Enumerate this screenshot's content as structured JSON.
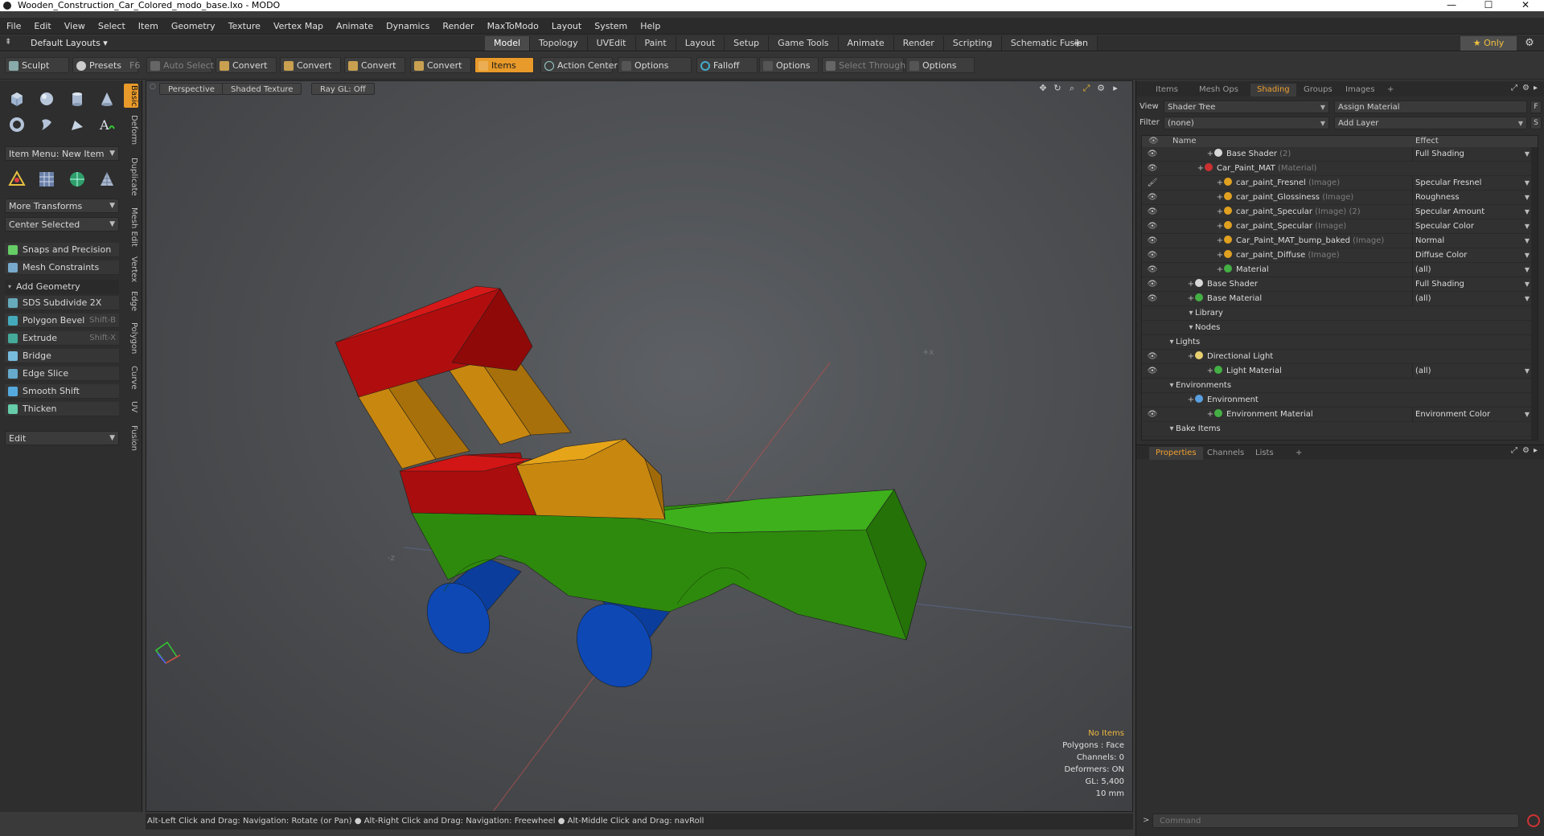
{
  "window": {
    "title": "Wooden_Construction_Car_Colored_modo_base.lxo - MODO",
    "minimize": "—",
    "maximize": "☐",
    "close": "✕"
  },
  "menu": [
    "File",
    "Edit",
    "View",
    "Select",
    "Item",
    "Geometry",
    "Texture",
    "Vertex Map",
    "Animate",
    "Dynamics",
    "Render",
    "MaxToModo",
    "Layout",
    "System",
    "Help"
  ],
  "layout": {
    "name": "Default Layouts ▾",
    "tabs": [
      "Model",
      "Topology",
      "UVEdit",
      "Paint",
      "Layout",
      "Setup",
      "Game Tools",
      "Animate",
      "Render",
      "Scripting",
      "Schematic Fusion"
    ],
    "active_tab": "Model",
    "add": "+",
    "only": "★  Only",
    "gear": "⚙"
  },
  "toolbar": {
    "sculpt": "Sculpt",
    "presets": "Presets",
    "presets_shortcut": "F6",
    "auto_select": "Auto Select",
    "convert1": "Convert",
    "convert2": "Convert",
    "convert3": "Convert",
    "convert4": "Convert",
    "items": "Items",
    "action_center": "Action Center",
    "options1": "Options",
    "falloff": "Falloff",
    "options2": "Options",
    "select_through": "Select Through",
    "options3": "Options"
  },
  "left": {
    "vtabs": [
      "Basic",
      "Deform",
      "Duplicate",
      "Mesh Edit",
      "Vertex",
      "Edge",
      "Polygon",
      "Curve",
      "UV",
      "Fusion"
    ],
    "item_menu": "Item Menu: New Item",
    "more_transforms": "More Transforms",
    "center_selected": "Center Selected",
    "snaps": "Snaps and Precision",
    "mesh_constraints": "Mesh Constraints",
    "add_geometry": "Add Geometry",
    "tools": [
      {
        "label": "SDS Subdivide 2X",
        "shortcut": ""
      },
      {
        "label": "Polygon Bevel",
        "shortcut": "Shift-B"
      },
      {
        "label": "Extrude",
        "shortcut": "Shift-X"
      },
      {
        "label": "Bridge",
        "shortcut": ""
      },
      {
        "label": "Edge Slice",
        "shortcut": ""
      },
      {
        "label": "Smooth Shift",
        "shortcut": ""
      },
      {
        "label": "Thicken",
        "shortcut": ""
      }
    ],
    "edit": "Edit"
  },
  "viewport": {
    "perspective": "Perspective",
    "shaded": "Shaded Texture",
    "raygl": "Ray GL: Off",
    "stats": {
      "items": "No Items",
      "polygons": "Polygons : Face",
      "channels": "Channels: 0",
      "deformers": "Deformers: ON",
      "gl": "GL: 5,400",
      "scale": "10 mm"
    }
  },
  "status": "Alt-Left Click and Drag: Navigation: Rotate (or Pan) ● Alt-Right Click and Drag: Navigation: Freewheel ● Alt-Middle Click and Drag: navRoll",
  "right": {
    "tabs": [
      "Items",
      "Mesh Ops",
      "Shading",
      "Groups",
      "Images",
      "+"
    ],
    "active_tab": "Shading",
    "view_label": "View",
    "view_value": "Shader Tree",
    "assign": "Assign Material",
    "f_btn": "F",
    "filter_label": "Filter",
    "filter_value": "(none)",
    "add_layer": "Add Layer",
    "s_btn": "S",
    "col_name": "Name",
    "col_effect": "Effect",
    "rows": [
      {
        "name": "Base Shader",
        "sub": "(2)",
        "effect": "Full Shading",
        "indent": 5,
        "color": "#d8d8d8",
        "eye": "👁"
      },
      {
        "name": "Car_Paint_MAT",
        "sub": "(Material)",
        "effect": "",
        "indent": 4,
        "color": "#cc3030",
        "eye": "👁"
      },
      {
        "name": "car_paint_Fresnel",
        "sub": "(Image)",
        "effect": "Specular Fresnel",
        "indent": 6,
        "color": "#e0a020",
        "eye": "🖌"
      },
      {
        "name": "car_paint_Glossiness",
        "sub": "(Image)",
        "effect": "Roughness",
        "indent": 6,
        "color": "#e0a020",
        "eye": "👁"
      },
      {
        "name": "car_paint_Specular",
        "sub": "(Image) (2)",
        "effect": "Specular Amount",
        "indent": 6,
        "color": "#e0a020",
        "eye": "👁"
      },
      {
        "name": "car_paint_Specular",
        "sub": "(Image)",
        "effect": "Specular Color",
        "indent": 6,
        "color": "#e0a020",
        "eye": "👁"
      },
      {
        "name": "Car_Paint_MAT_bump_baked",
        "sub": "(Image)",
        "effect": "Normal",
        "indent": 6,
        "color": "#e0a020",
        "eye": "👁"
      },
      {
        "name": "car_paint_Diffuse",
        "sub": "(Image)",
        "effect": "Diffuse Color",
        "indent": 6,
        "color": "#e0a020",
        "eye": "👁"
      },
      {
        "name": "Material",
        "sub": "",
        "effect": "(all)",
        "indent": 6,
        "color": "#44b044",
        "eye": "👁"
      },
      {
        "name": "Base Shader",
        "sub": "",
        "effect": "Full Shading",
        "indent": 3,
        "color": "#d8d8d8",
        "eye": "👁"
      },
      {
        "name": "Base Material",
        "sub": "",
        "effect": "(all)",
        "indent": 3,
        "color": "#44b044",
        "eye": "👁"
      },
      {
        "name": "Library",
        "sub": "",
        "effect": "",
        "indent": 3,
        "color": "",
        "eye": ""
      },
      {
        "name": "Nodes",
        "sub": "",
        "effect": "",
        "indent": 3,
        "color": "",
        "eye": ""
      },
      {
        "name": "Lights",
        "sub": "",
        "effect": "",
        "indent": 1,
        "color": "",
        "eye": ""
      },
      {
        "name": "Directional Light",
        "sub": "",
        "effect": "",
        "indent": 3,
        "color": "#e8d070",
        "eye": "👁"
      },
      {
        "name": "Light Material",
        "sub": "",
        "effect": "(all)",
        "indent": 5,
        "color": "#44b044",
        "eye": "👁"
      },
      {
        "name": "Environments",
        "sub": "",
        "effect": "",
        "indent": 1,
        "color": "",
        "eye": ""
      },
      {
        "name": "Environment",
        "sub": "",
        "effect": "",
        "indent": 3,
        "color": "#5aa0e0",
        "eye": ""
      },
      {
        "name": "Environment Material",
        "sub": "",
        "effect": "Environment Color",
        "indent": 5,
        "color": "#44b044",
        "eye": "👁"
      },
      {
        "name": "Bake Items",
        "sub": "",
        "effect": "",
        "indent": 1,
        "color": "",
        "eye": ""
      }
    ],
    "props_tabs": [
      "Properties",
      "Channels",
      "Lists",
      "+"
    ],
    "props_active": "Properties",
    "cmd_arrow": ">",
    "cmd_placeholder": "Command"
  }
}
